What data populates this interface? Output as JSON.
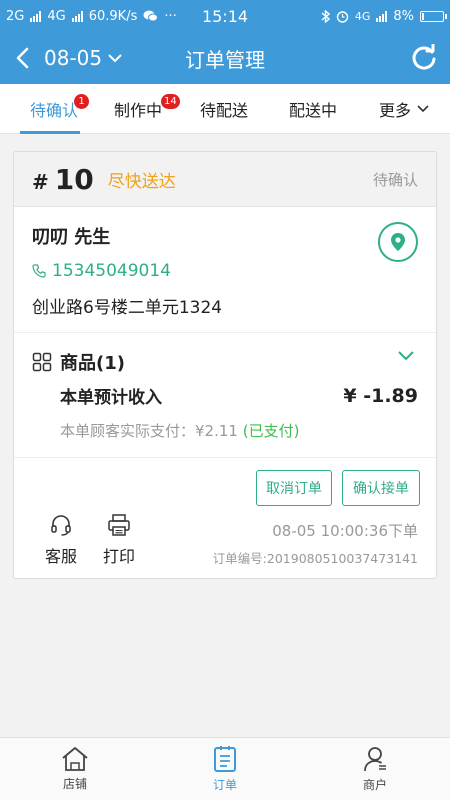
{
  "status_bar": {
    "net1": "2G",
    "net2": "4G",
    "speed": "60.9K/s",
    "time": "15:14",
    "net3": "4G",
    "battery_percent": "8%",
    "battery_level": 0.08
  },
  "header": {
    "date": "08-05",
    "title": "订单管理"
  },
  "tabs": [
    {
      "label": "待确认",
      "badge": "1",
      "active": true
    },
    {
      "label": "制作中",
      "badge": "14",
      "active": false
    },
    {
      "label": "待配送",
      "badge": "",
      "active": false
    },
    {
      "label": "配送中",
      "badge": "",
      "active": false
    },
    {
      "label": "更多",
      "badge": "",
      "active": false
    }
  ],
  "order": {
    "hash": "#",
    "number": "10",
    "delivery": "尽快送达",
    "status": "待确认",
    "customer_name": "叨叨 先生",
    "phone": "15345049014",
    "address": "创业路6号楼二单元1324",
    "goods_title": "商品(1)",
    "income_label": "本单预计收入",
    "income_amount": "¥ -1.89",
    "paid_prefix": "本单顾客实际支付：¥2.11",
    "paid_status": "(已支付)",
    "cancel_label": "取消订单",
    "confirm_label": "确认接单",
    "service_label": "客服",
    "print_label": "打印",
    "order_time": "08-05 10:00:36下单",
    "order_id": "订单编号:2019080510037473141"
  },
  "bottom_nav": [
    {
      "label": "店铺",
      "icon": "home-icon",
      "active": false
    },
    {
      "label": "订单",
      "icon": "order-list-icon",
      "active": true
    },
    {
      "label": "商户",
      "icon": "merchant-icon",
      "active": false
    }
  ],
  "colors": {
    "primary": "#3f9ad9",
    "accent_green": "#2fae8a",
    "warning_orange": "#f0a21b",
    "badge_red": "#e02020",
    "paid_green": "#3fbf4f"
  }
}
